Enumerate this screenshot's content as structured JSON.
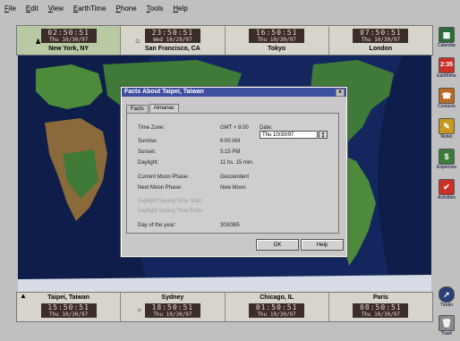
{
  "menu": [
    "File",
    "Edit",
    "View",
    "EarthTime",
    "Phone",
    "Tools",
    "Help"
  ],
  "top_clocks": [
    {
      "time": "02:50:51",
      "date": "Thu 10/30/97",
      "city": "New York, NY",
      "selected": true,
      "marker": "person-icon"
    },
    {
      "time": "23:50:51",
      "date": "Wed 10/29/97",
      "city": "San Francisco, CA",
      "selected": false,
      "marker": "home-icon"
    },
    {
      "time": "16:50:51",
      "date": "Thu 10/30/97",
      "city": "Tokyo",
      "selected": false,
      "marker": ""
    },
    {
      "time": "07:50:51",
      "date": "Thu 10/30/97",
      "city": "London",
      "selected": false,
      "marker": ""
    }
  ],
  "bottom_clocks": [
    {
      "time": "15:50:51",
      "date": "Thu 10/30/97",
      "city": "Taipei, Taiwan",
      "marker": "up-arrow-icon"
    },
    {
      "time": "18:50:51",
      "date": "Thu 10/30/97",
      "city": "Sydney",
      "marker": "circle-icon"
    },
    {
      "time": "01:50:51",
      "date": "Thu 10/30/97",
      "city": "Chicago, IL",
      "marker": ""
    },
    {
      "time": "08:50:51",
      "date": "Thu 10/30/97",
      "city": "Paris",
      "marker": ""
    }
  ],
  "toolbar": [
    {
      "icon": "calendar-icon",
      "label": "Calendar",
      "glyph": "▦",
      "color": "#2d6a3a"
    },
    {
      "icon": "clock-icon",
      "label": "Earthtime",
      "glyph": "2:35",
      "color": "#c83028"
    },
    {
      "icon": "contacts-icon",
      "label": "Contacts",
      "glyph": "☎",
      "color": "#b86a20"
    },
    {
      "icon": "notes-icon",
      "label": "Notes",
      "glyph": "✎",
      "color": "#c69a20"
    },
    {
      "icon": "expenses-icon",
      "label": "Expenses",
      "glyph": "$",
      "color": "#3a7a3a"
    },
    {
      "icon": "activities-icon",
      "label": "Activities",
      "glyph": "✔",
      "color": "#c83028"
    }
  ],
  "bottom_tools": [
    {
      "icon": "compass-icon",
      "label": "Tickler"
    },
    {
      "icon": "trash-icon",
      "label": "Trash"
    }
  ],
  "dialog": {
    "title": "Facts About Taipei, Taiwan",
    "tabs": [
      "Facts",
      "Almanac"
    ],
    "active_tab": 1,
    "fields": [
      {
        "label": "Time Zone:",
        "value": "GMT + 8:00"
      },
      {
        "label": "Sunrise:",
        "value": "6:00 AM"
      },
      {
        "label": "Sunset:",
        "value": "5:15 PM"
      },
      {
        "label": "Daylight:",
        "value": "11 hs. 15 min."
      },
      {
        "label": "Current Moon Phase:",
        "value": "Descendent"
      },
      {
        "label": "Next Moon Phase:",
        "value": "New Moon"
      },
      {
        "label": "Daylight Saving Time Start:",
        "value": ""
      },
      {
        "label": "Daylight Saving Time Ends:",
        "value": ""
      },
      {
        "label": "Day of the year:",
        "value": "303/365"
      }
    ],
    "date_label": "Date:",
    "date_value": "Thu   10/30/97",
    "ok_label": "OK",
    "help_label": "Help",
    "close_glyph": "x"
  },
  "colors": {
    "ocean": "#13265e",
    "land_green": "#3f7a38",
    "land_brown": "#8a6a3a",
    "night_shade": "#0b1638",
    "title_bar": "#3e4fa0"
  }
}
